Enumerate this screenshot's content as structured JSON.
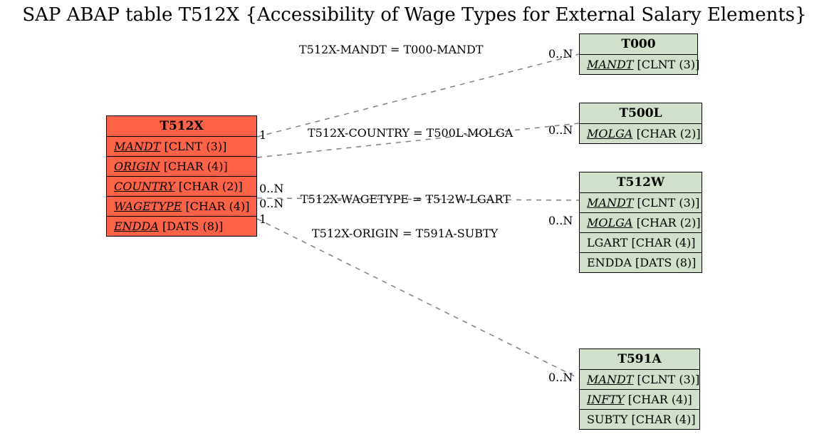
{
  "title": "SAP ABAP table T512X {Accessibility of Wage Types for External Salary Elements}",
  "colors": {
    "source_table": "#ff6347",
    "target_table": "#d0e0ca",
    "line": "#808080"
  },
  "tables": {
    "t512x": {
      "name": "T512X",
      "role": "source",
      "fields": [
        {
          "name": "MANDT",
          "type": "[CLNT (3)]",
          "key": true
        },
        {
          "name": "ORIGIN",
          "type": "[CHAR (4)]",
          "key": true
        },
        {
          "name": "COUNTRY",
          "type": "[CHAR (2)]",
          "key": true
        },
        {
          "name": "WAGETYPE",
          "type": "[CHAR (4)]",
          "key": true
        },
        {
          "name": "ENDDA",
          "type": "[DATS (8)]",
          "key": true
        }
      ]
    },
    "t000": {
      "name": "T000",
      "fields": [
        {
          "name": "MANDT",
          "type": "[CLNT (3)]",
          "key": true
        }
      ]
    },
    "t500l": {
      "name": "T500L",
      "fields": [
        {
          "name": "MOLGA",
          "type": "[CHAR (2)]",
          "key": true
        }
      ]
    },
    "t512w": {
      "name": "T512W",
      "fields": [
        {
          "name": "MANDT",
          "type": "[CLNT (3)]",
          "key": true
        },
        {
          "name": "MOLGA",
          "type": "[CHAR (2)]",
          "key": true
        },
        {
          "name": "LGART",
          "type": "[CHAR (4)]",
          "key": false
        },
        {
          "name": "ENDDA",
          "type": "[DATS (8)]",
          "key": false
        }
      ]
    },
    "t591a": {
      "name": "T591A",
      "fields": [
        {
          "name": "MANDT",
          "type": "[CLNT (3)]",
          "key": true
        },
        {
          "name": "INFTY",
          "type": "[CHAR (4)]",
          "key": true
        },
        {
          "name": "SUBTY",
          "type": "[CHAR (4)]",
          "key": false
        }
      ]
    }
  },
  "relations": [
    {
      "from": "T512X",
      "to": "T000",
      "expr": "T512X-MANDT = T000-MANDT",
      "left_card": "1",
      "right_card": "0..N"
    },
    {
      "from": "T512X",
      "to": "T500L",
      "expr": "T512X-COUNTRY = T500L-MOLGA",
      "left_card": "0..N",
      "right_card": "0..N"
    },
    {
      "from": "T512X",
      "to": "T512W",
      "expr": "T512X-WAGETYPE = T512W-LGART",
      "left_card": "0..N",
      "right_card": "0..N"
    },
    {
      "from": "T512X",
      "to": "T591A",
      "expr": "T512X-ORIGIN = T591A-SUBTY",
      "left_card": "1",
      "right_card": "0..N"
    }
  ]
}
